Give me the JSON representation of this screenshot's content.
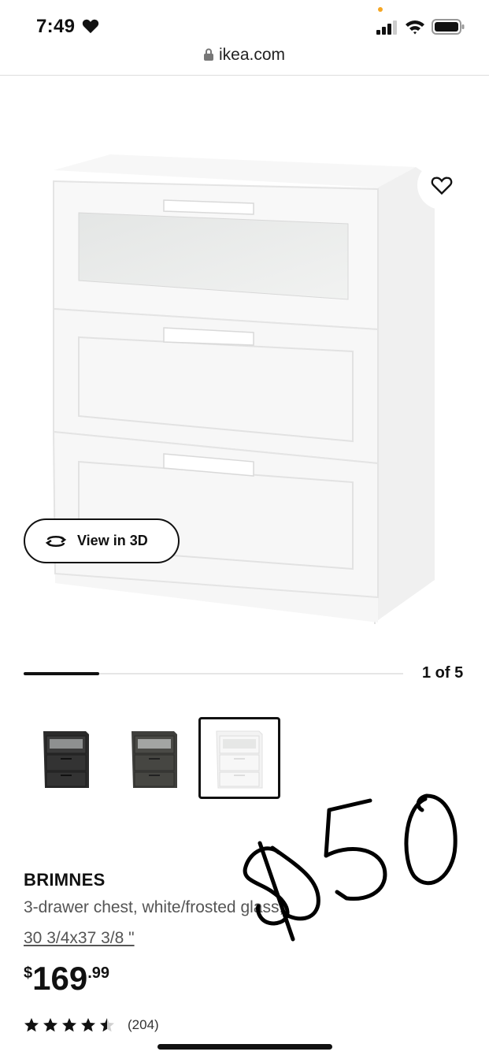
{
  "status_bar": {
    "time": "7:49"
  },
  "browser": {
    "url": "ikea.com"
  },
  "hero": {
    "view_3d_label": "View in 3D"
  },
  "carousel": {
    "position_label": "1 of 5",
    "progress": 0.2
  },
  "thumbnails": [
    {
      "variant": "black-brown"
    },
    {
      "variant": "dark-gray"
    },
    {
      "variant": "white",
      "selected": true
    }
  ],
  "product": {
    "name": "BRIMNES",
    "description": "3-drawer chest, white/frosted glass,",
    "size": "30 3/4x37 3/8 \"",
    "price_currency": "$",
    "price_integer": "169",
    "price_decimal": ".99",
    "rating": 4.5,
    "review_count": "(204)"
  },
  "annotation": {
    "handwritten_price": "$50"
  },
  "colors": {
    "accent": "#111111",
    "status_dot": "#f5a623"
  }
}
